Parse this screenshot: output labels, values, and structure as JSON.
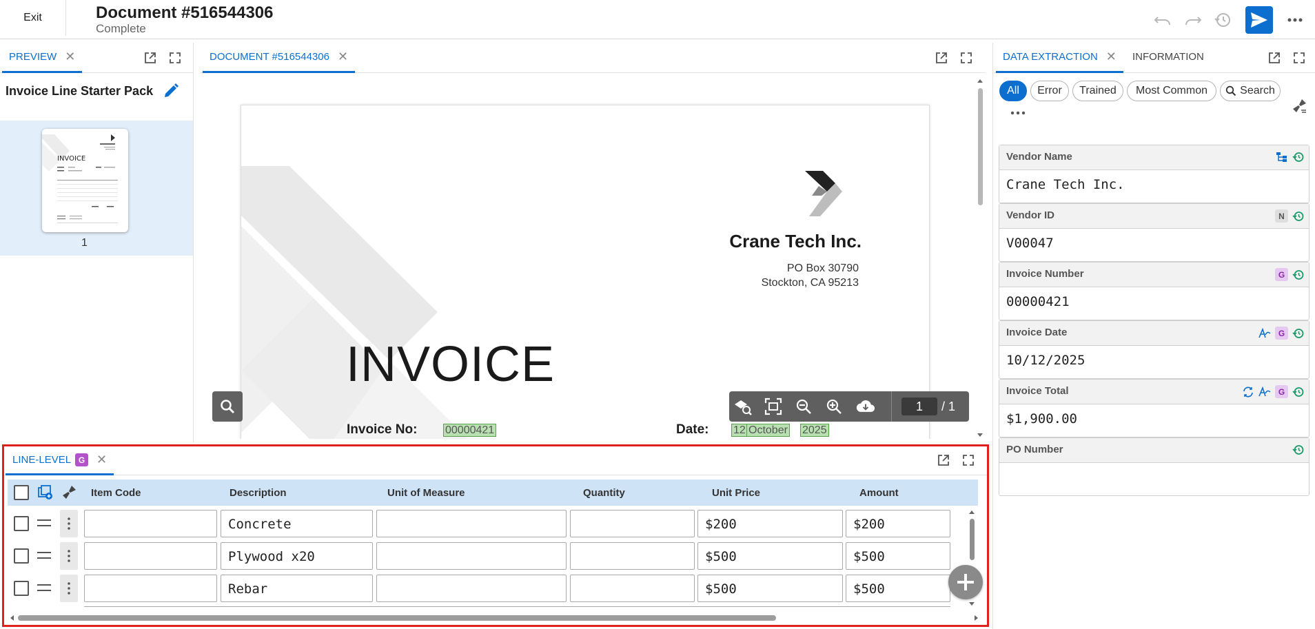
{
  "topbar": {
    "exit_label": "Exit",
    "title": "Document #516544306",
    "status": "Complete"
  },
  "preview": {
    "tab_label": "PREVIEW",
    "pack_title": "Invoice Line Starter Pack",
    "page_number": "1"
  },
  "document": {
    "tab_label": "DOCUMENT #516544306",
    "company": "Crane Tech Inc.",
    "address_line1": "PO Box 30790",
    "address_line2": "Stockton, CA 95213",
    "heading": "INVOICE",
    "invoice_no_label": "Invoice No:",
    "invoice_no_value": "00000421",
    "date_label": "Date:",
    "date_day": "12",
    "date_month": "October",
    "date_year": "2025",
    "current_page": "1",
    "total_pages": "/ 1"
  },
  "extraction": {
    "tab_label": "DATA EXTRACTION",
    "info_tab_label": "INFORMATION",
    "filters": [
      "All",
      "Error",
      "Trained",
      "Most Common",
      "Search"
    ],
    "fields": [
      {
        "label": "Vendor Name",
        "value": "Crane Tech Inc."
      },
      {
        "label": "Vendor ID",
        "value": "V00047",
        "badge": "N"
      },
      {
        "label": "Invoice Number",
        "value": "00000421",
        "badge": "G"
      },
      {
        "label": "Invoice Date",
        "value": "10/12/2025",
        "badge": "G"
      },
      {
        "label": "Invoice Total",
        "value": "$1,900.00",
        "badge": "G"
      },
      {
        "label": "PO Number",
        "value": ""
      }
    ]
  },
  "line_level": {
    "tab_label": "LINE-LEVEL",
    "badge": "G",
    "columns": [
      "Item Code",
      "Description",
      "Unit of Measure",
      "Quantity",
      "Unit Price",
      "Amount"
    ],
    "rows": [
      {
        "item_code": "",
        "description": "Concrete",
        "uom": "",
        "quantity": "",
        "unit_price": "$200",
        "amount": "$200"
      },
      {
        "item_code": "",
        "description": "Plywood x20",
        "uom": "",
        "quantity": "",
        "unit_price": "$500",
        "amount": "$500"
      },
      {
        "item_code": "",
        "description": "Rebar",
        "uom": "",
        "quantity": "",
        "unit_price": "$500",
        "amount": "$500"
      }
    ]
  },
  "colors": {
    "accent": "#0c6fcf",
    "badge_g": "#b452cc",
    "highlight_border": "#e0201c"
  }
}
